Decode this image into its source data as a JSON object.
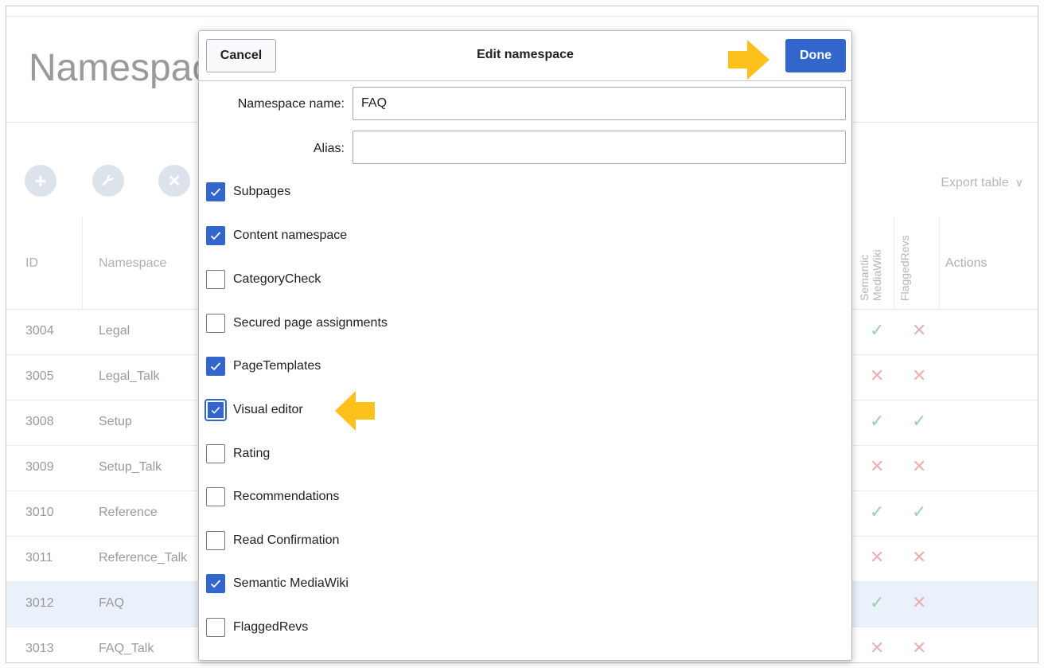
{
  "page": {
    "title": "Namespace"
  },
  "toolbar": {
    "add_icon": "plus-icon",
    "edit_icon": "wrench-icon",
    "delete_icon": "close-icon",
    "export_label": "Export table"
  },
  "table": {
    "headers": {
      "id": "ID",
      "namespace": "Namespace",
      "semantic_mediawiki": "Semantic MediaWiki",
      "flaggedrevs": "FlaggedRevs",
      "actions": "Actions"
    },
    "rows": [
      {
        "id": "3004",
        "namespace": "Legal",
        "smw": "check",
        "fr": "cross"
      },
      {
        "id": "3005",
        "namespace": "Legal_Talk",
        "smw": "cross",
        "fr": "cross"
      },
      {
        "id": "3008",
        "namespace": "Setup",
        "smw": "check",
        "fr": "check"
      },
      {
        "id": "3009",
        "namespace": "Setup_Talk",
        "smw": "cross",
        "fr": "cross"
      },
      {
        "id": "3010",
        "namespace": "Reference",
        "smw": "check",
        "fr": "check"
      },
      {
        "id": "3011",
        "namespace": "Reference_Talk",
        "smw": "cross",
        "fr": "cross"
      },
      {
        "id": "3012",
        "namespace": "FAQ",
        "smw": "check",
        "fr": "cross"
      },
      {
        "id": "3013",
        "namespace": "FAQ_Talk",
        "smw": "cross",
        "fr": "cross"
      }
    ],
    "symbols": {
      "check": "✓",
      "cross": "✕"
    }
  },
  "dialog": {
    "title": "Edit namespace",
    "cancel_label": "Cancel",
    "done_label": "Done",
    "name_label": "Namespace name:",
    "name_value": "FAQ",
    "alias_label": "Alias:",
    "alias_value": "",
    "options": [
      {
        "label": "Subpages",
        "checked": true
      },
      {
        "label": "Content namespace",
        "checked": true
      },
      {
        "label": "CategoryCheck",
        "checked": false
      },
      {
        "label": "Secured page assignments",
        "checked": false
      },
      {
        "label": "PageTemplates",
        "checked": true
      },
      {
        "label": "Visual editor",
        "checked": true,
        "focused": true
      },
      {
        "label": "Rating",
        "checked": false
      },
      {
        "label": "Recommendations",
        "checked": false
      },
      {
        "label": "Read Confirmation",
        "checked": false
      },
      {
        "label": "Semantic MediaWiki",
        "checked": true
      },
      {
        "label": "FlaggedRevs",
        "checked": false
      }
    ]
  },
  "annotations": {
    "arrow_color": "#fcc21b"
  },
  "colors": {
    "primary": "#3366cc",
    "selected_row": "#eaf1fb"
  }
}
